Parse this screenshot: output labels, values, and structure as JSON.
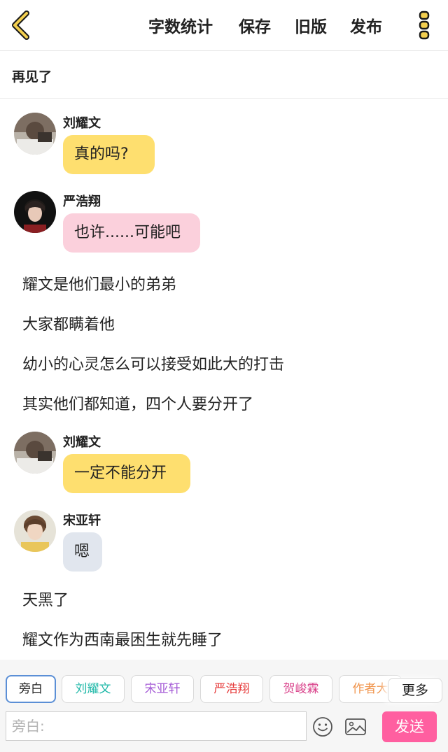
{
  "toolbar": {
    "word_count": "字数统计",
    "save": "保存",
    "old_version": "旧版",
    "publish": "发布"
  },
  "chapter": {
    "title": "再见了"
  },
  "messages": [
    {
      "type": "dialog",
      "sender": "刘耀文",
      "text": "真的吗?",
      "bubble_color": "#fedf6f"
    },
    {
      "type": "dialog",
      "sender": "严浩翔",
      "text": "也许......可能吧",
      "bubble_color": "#fbd0dc"
    },
    {
      "type": "narration",
      "text": "耀文是他们最小的弟弟"
    },
    {
      "type": "narration",
      "text": "大家都瞒着他"
    },
    {
      "type": "narration",
      "text": "幼小的心灵怎么可以接受如此大的打击"
    },
    {
      "type": "narration",
      "text": "其实他们都知道，四个人要分开了"
    },
    {
      "type": "dialog",
      "sender": "刘耀文",
      "text": "一定不能分开",
      "bubble_color": "#fedf6f"
    },
    {
      "type": "dialog",
      "sender": "宋亚轩",
      "text": "嗯",
      "bubble_color": "#e1e6ee"
    },
    {
      "type": "narration",
      "text": "天黑了"
    },
    {
      "type": "narration",
      "text": "耀文作为西南最困生就先睡了"
    }
  ],
  "roles": [
    {
      "label": "旁白",
      "color": "#222222",
      "active": true
    },
    {
      "label": "刘耀文",
      "color": "#1fb8a8"
    },
    {
      "label": "宋亚轩",
      "color": "#a45ad6"
    },
    {
      "label": "严浩翔",
      "color": "#e63b3b"
    },
    {
      "label": "贺峻霖",
      "color": "#d9418a"
    },
    {
      "label": "作者大",
      "color": "#f0934a"
    }
  ],
  "more_label": "更多",
  "input": {
    "placeholder": "旁白:"
  },
  "send_label": "发送",
  "colors": {
    "accent": "#fedf6f",
    "send": "#ff5fa0",
    "active_role_border": "#5b8fd6"
  }
}
